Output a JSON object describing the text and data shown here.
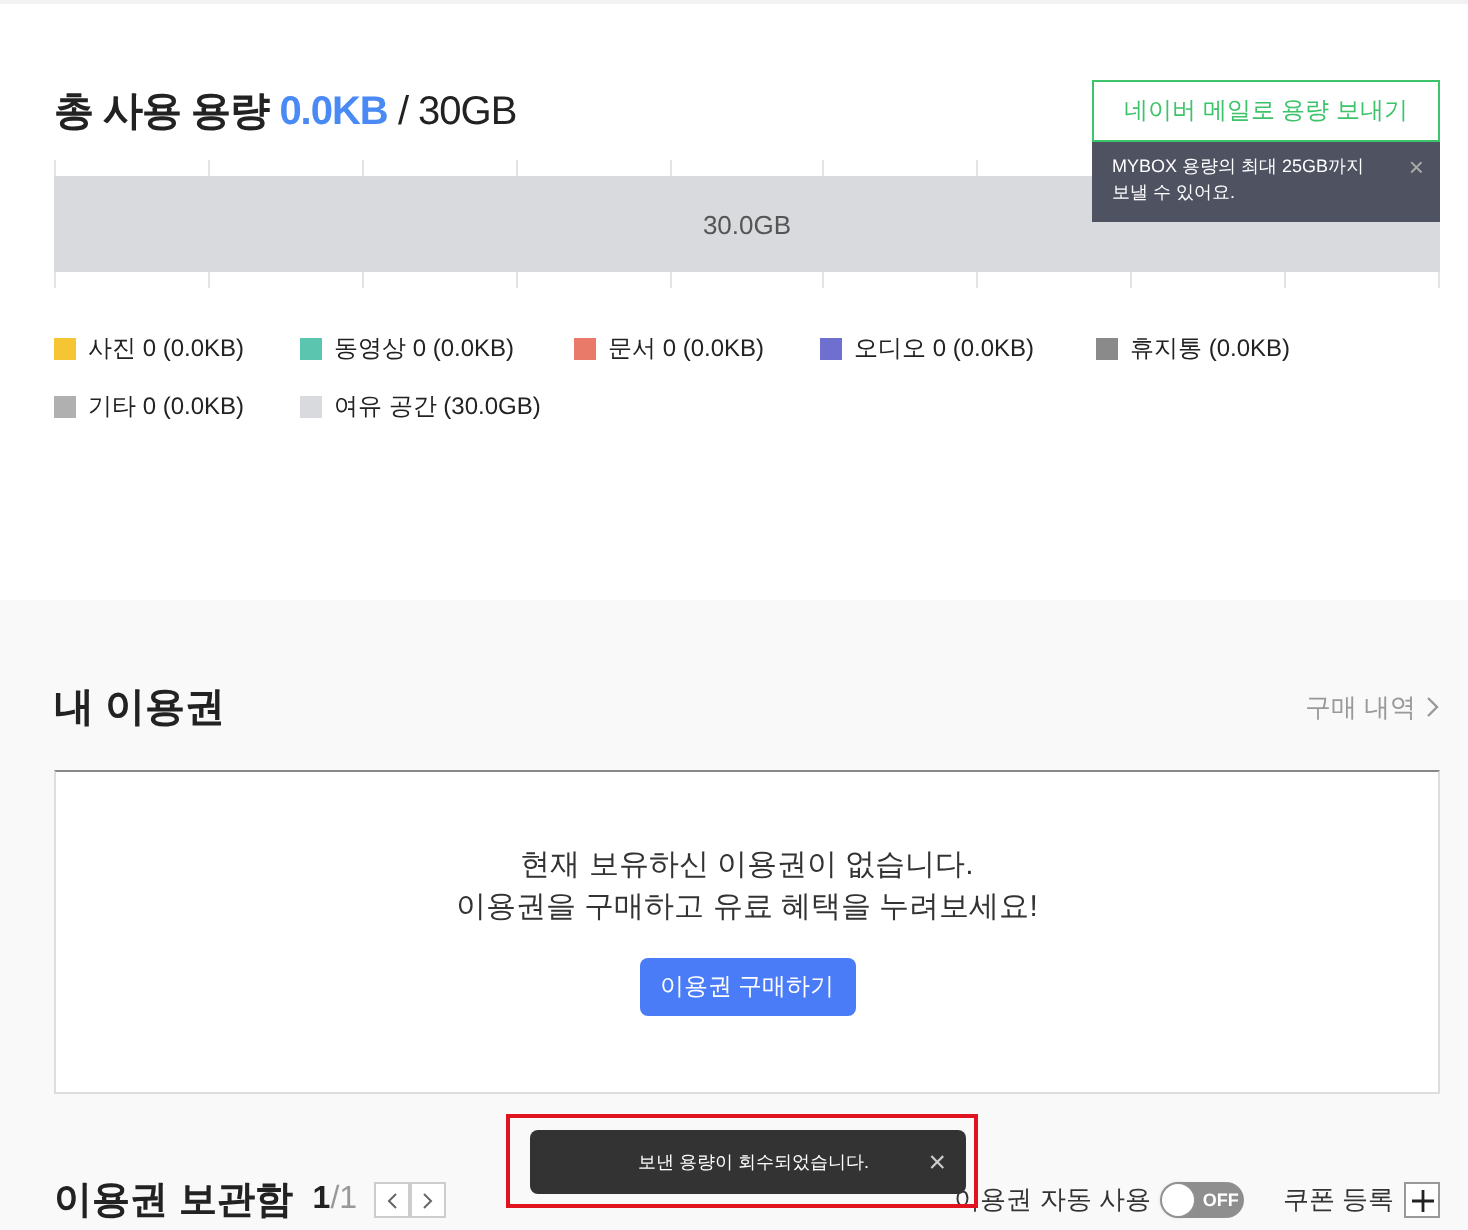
{
  "usage": {
    "title": "총 사용 용량",
    "used": "0.0KB",
    "total": "/ 30GB",
    "send_button": "네이버 메일로 용량 보내기",
    "tooltip": {
      "text": "MYBOX 용량의 최대 25GB까지 보낼 수 있어요.",
      "close": "×"
    },
    "bar": {
      "label": "30.0GB",
      "level": 1
    },
    "legend": [
      {
        "label": "사진 0 (0.0KB)",
        "color": "#f5c533"
      },
      {
        "label": "동영상 0 (0.0KB)",
        "color": "#5cc5b0"
      },
      {
        "label": "문서 0 (0.0KB)",
        "color": "#e97a6a"
      },
      {
        "label": "오디오 0 (0.0KB)",
        "color": "#6f6fd0"
      },
      {
        "label": "휴지통 (0.0KB)",
        "color": "#8a8a8a"
      },
      {
        "label": "기타 0 (0.0KB)",
        "color": "#b0b0b0"
      },
      {
        "label": "여유 공간 (30.0GB)",
        "color": "#d8dadd"
      }
    ]
  },
  "passes": {
    "title": "내 이용권",
    "history_link": "구매 내역",
    "empty_lines": [
      "현재 보유하신 이용권이 없습니다.",
      "이용권을 구매하고 유료 혜택을 누려보세요!"
    ],
    "buy_button": "이용권 구매하기"
  },
  "storage": {
    "title": "이용권 보관함",
    "page": "1",
    "pages": "/1",
    "auto_use_label": "이용권 자동 사용",
    "auto_use": {
      "on": false,
      "label": "OFF"
    },
    "coupon_label": "쿠폰 등록"
  },
  "toast": {
    "text": "보낸 용량이 회수되었습니다.",
    "close": "×"
  }
}
